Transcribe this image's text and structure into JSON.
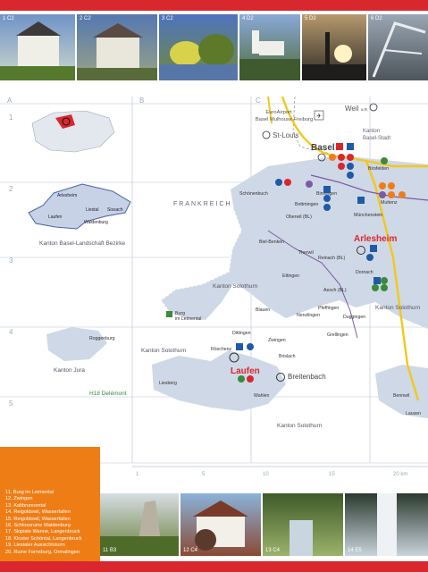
{
  "photos_top": [
    {
      "code": "1 C2",
      "color1": "#6f93c8",
      "color2": "#cfd9cc"
    },
    {
      "code": "2 C2",
      "color1": "#5577b0",
      "color2": "#9aa586"
    },
    {
      "code": "3 C2",
      "color1": "#4f73c0",
      "color2": "#6f8a3a"
    },
    {
      "code": "4 D2",
      "color1": "#8aa9d8",
      "color2": "#4f6b3a"
    },
    {
      "code": "5 D2",
      "color1": "#b79a6d",
      "color2": "#2d2a26"
    },
    {
      "code": "6 D2",
      "color1": "#9aa6b3",
      "color2": "#4d555c"
    }
  ],
  "grid": {
    "columns": [
      "A",
      "B",
      "C"
    ],
    "rows": [
      "1",
      "2",
      "3",
      "4",
      "5"
    ]
  },
  "places": {
    "basel": "Basel",
    "arlesheim": "Arlesheim",
    "laufen": "Laufen",
    "st_louis": "St-Louis",
    "weil": "Weil",
    "weil_suffix": "a.R.",
    "airport_1": "EuroAirport",
    "airport_2": "Basel Mulhouse Freiburg",
    "kanton_bs_1": "Kanton",
    "kanton_bs_2": "Basel-Stadt",
    "birsfelden": "Birsfelden",
    "muttenz": "Muttenz",
    "munchenstein": "Münchenstein",
    "binningen": "Binningen",
    "bottmingen": "Bottmingen",
    "oberwil": "Oberwil (BL)",
    "schonenbuch": "Schönenbuch",
    "therwil": "Therwil",
    "reinach": "Reinach (BL)",
    "dornach": "Dornach",
    "aesch": "Aesch (BL)",
    "pfeffingen": "Pfeffingen",
    "duggingen": "Duggingen",
    "grellingen": "Grellingen",
    "nenzlingen": "Nenzlingen",
    "blauen": "Blauen",
    "zwingen": "Zwingen",
    "dittingen": "Dittingen",
    "roschenz": "Röschenz",
    "brislach": "Brislach",
    "wahlen": "Wahlen",
    "breitenbach": "Breitenbach",
    "liesberg": "Liesberg",
    "roggenburg": "Roggenburg",
    "burg_1": "Burg",
    "burg_2": "im Leimental",
    "biel_benken": "Biel-Benken",
    "ettingen": "Ettingen",
    "frankreich": "FRANKREICH",
    "kanton_so_1": "Kanton Solothurn",
    "kanton_so_2": "Kanton Solothurn",
    "kanton_so_3": "Kanton Solothurn",
    "kanton_so_4": "Kanton Solothurn",
    "kanton_jura": "Kanton Jura",
    "h18": "H18 Delémont",
    "bezirke": "Kanton Basel-Landschaft Bezirke",
    "bez_arlesheim": "Arlesheim",
    "bez_liestal": "Liestal",
    "bez_sissach": "Sissach",
    "bez_laufen": "Laufen",
    "bez_waldenburg": "Waldenburg",
    "lausen": "Lausen",
    "bennwil": "Bennwil"
  },
  "scale": {
    "ticks": [
      "1",
      "5",
      "10",
      "15",
      "20 km"
    ]
  },
  "legend": [
    "11. Burg im Leimental",
    "12. Zwingen",
    "13. Kaltbrunnental",
    "14. Reigoldswil, Wasserfallen",
    "15. Reigoldswil, Wasserfallen",
    "16. Schlossruine Waldenburg",
    "17. Skipiste Wanne, Langenbruck",
    "18. Kloster Schöntal, Langenbruck",
    "19. Liestaler Aussichtsturm",
    "20. Ruine Farnsburg, Ormalingen"
  ],
  "photos_bottom": [
    {
      "code": "11 B3",
      "color1": "#d6dee4",
      "color2": "#6b7f3b"
    },
    {
      "code": "12 C4",
      "color1": "#8ab3d9",
      "color2": "#8a4a35"
    },
    {
      "code": "13 C4",
      "color1": "#3f5a2a",
      "color2": "#9bb36a"
    },
    {
      "code": "14 E5",
      "color1": "#2b3a2f",
      "color2": "#c9d4dc"
    }
  ],
  "colors": {
    "accent_red": "#d9272e",
    "accent_orange": "#ef7d16",
    "region_fill": "#cfd8e6",
    "route_purple": "#7b5aa6",
    "highway_yellow": "#f2c81c"
  }
}
